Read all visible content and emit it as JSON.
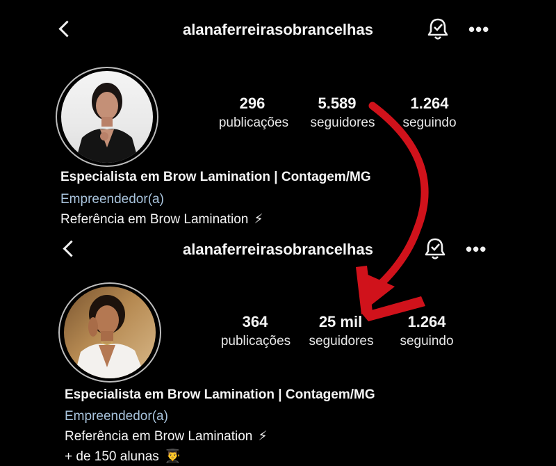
{
  "profile_old": {
    "username": "alanaferreirasobrancelhas",
    "stats": [
      {
        "value": "296",
        "label": "publicações"
      },
      {
        "value": "5.589",
        "label": "seguidores"
      },
      {
        "value": "1.264",
        "label": "seguindo"
      }
    ],
    "bio_name": "Especialista em Brow Lamination | Contagem/MG",
    "category": "Empreendedor(a)",
    "bio_lines": [
      "Referência em Brow Lamination"
    ],
    "bio_emojis": [
      "⚡"
    ]
  },
  "profile_new": {
    "username": "alanaferreirasobrancelhas",
    "stats": [
      {
        "value": "364",
        "label": "publicações"
      },
      {
        "value": "25 mil",
        "label": "seguidores"
      },
      {
        "value": "1.264",
        "label": "seguindo"
      }
    ],
    "bio_name": "Especialista em Brow Lamination | Contagem/MG",
    "category": "Empreendedor(a)",
    "bio_lines": [
      "Referência em Brow Lamination",
      "+ de 150 alunas"
    ],
    "bio_emojis": [
      "⚡",
      "👨‍🎓"
    ]
  },
  "icons": {
    "back": "back-chevron-icon",
    "bell": "bell-check-icon",
    "more": "more-dots-icon",
    "arrow": "curved-arrow-icon"
  },
  "colors": {
    "background": "#000000",
    "arrow": "#d0121b",
    "category": "#a8c3dc"
  }
}
